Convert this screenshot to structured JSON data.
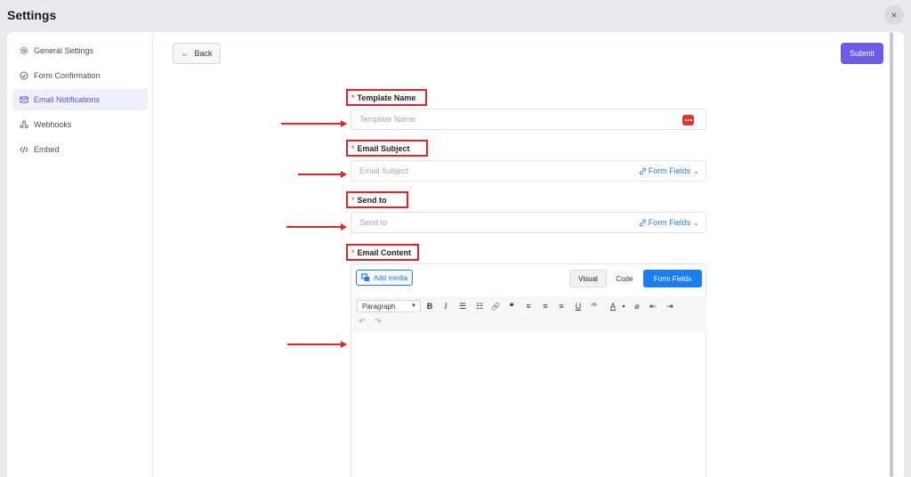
{
  "header": {
    "title": "Settings",
    "close_glyph": "×"
  },
  "sidebar": {
    "items": [
      {
        "label": "General Settings",
        "icon": "gear-icon"
      },
      {
        "label": "Form Confirmation",
        "icon": "check-circle-icon"
      },
      {
        "label": "Email Notifications",
        "icon": "mail-icon",
        "active": true
      },
      {
        "label": "Webhooks",
        "icon": "webhook-icon"
      },
      {
        "label": "Embed",
        "icon": "code-icon"
      }
    ]
  },
  "actions": {
    "back_label": "Back",
    "submit_label": "Submit"
  },
  "form": {
    "template_name": {
      "label": "Template Name",
      "placeholder": "Template Name"
    },
    "email_subject": {
      "label": "Email Subject",
      "placeholder": "Email Subject",
      "form_fields_label": "Form Fields"
    },
    "send_to": {
      "label": "Send to",
      "placeholder": "Send to",
      "form_fields_label": "Form Fields"
    },
    "email_content": {
      "label": "Email Content"
    },
    "required_marker": "*"
  },
  "editor": {
    "add_media_label": "Add media",
    "tabs": {
      "visual": "Visual",
      "code": "Code",
      "form_fields": "Form Fields"
    },
    "paragraph_label": "Paragraph",
    "toolbar_glyphs": {
      "bold": "B",
      "italic": "I",
      "bullet_list": "☰",
      "numbered_list": "☷",
      "link": "🔗",
      "blockquote": "❝",
      "align_left": "≡",
      "align_center": "≡",
      "align_right": "≡",
      "underline": "U",
      "strikethrough": "ᴬᴮᶜ",
      "text_color": "A",
      "color_caret": "▾",
      "clear_format": "⌀",
      "outdent": "⇤",
      "indent": "⇥",
      "undo": "↶",
      "redo": "↷"
    }
  },
  "colors": {
    "accent": "#6c5ce7",
    "link": "#2a7ae2",
    "annotation": "#e0242a"
  }
}
